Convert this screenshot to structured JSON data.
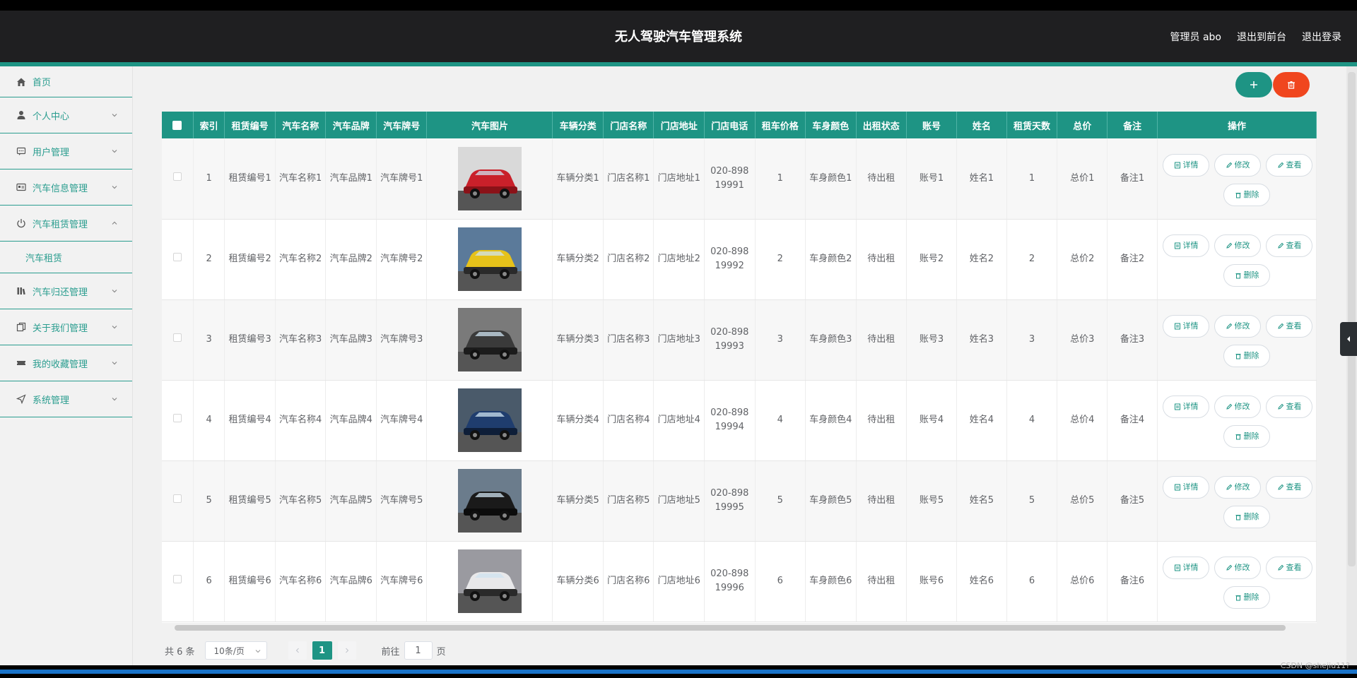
{
  "header": {
    "title": "无人驾驶汽车管理系统",
    "admin": "管理员 abo",
    "exit_front": "退出到前台",
    "logout": "退出登录"
  },
  "sidebar": {
    "items": [
      {
        "label": "首页",
        "icon": "home-icon"
      },
      {
        "label": "个人中心",
        "icon": "user-icon"
      },
      {
        "label": "用户管理",
        "icon": "chat-icon"
      },
      {
        "label": "汽车信息管理",
        "icon": "card-icon"
      },
      {
        "label": "汽车租赁管理",
        "icon": "power-icon",
        "expanded": true,
        "sub": "汽车租赁"
      },
      {
        "label": "汽车归还管理",
        "icon": "bars-icon"
      },
      {
        "label": "关于我们管理",
        "icon": "copy-icon"
      },
      {
        "label": "我的收藏管理",
        "icon": "ticket-icon"
      },
      {
        "label": "系统管理",
        "icon": "send-icon"
      }
    ]
  },
  "toolbar": {
    "add_icon": "+",
    "delete_icon": "trash"
  },
  "table": {
    "headers": [
      "索引",
      "租赁编号",
      "汽车名称",
      "汽车品牌",
      "汽车牌号",
      "汽车图片",
      "车辆分类",
      "门店名称",
      "门店地址",
      "门店电话",
      "租车价格",
      "车身颜色",
      "出租状态",
      "账号",
      "姓名",
      "租赁天数",
      "总价",
      "备注",
      "操作"
    ],
    "rows": [
      {
        "idx": "1",
        "no": "租赁编号1",
        "name": "汽车名称1",
        "brand": "汽车品牌1",
        "plate": "汽车牌号1",
        "cls": "车辆分类1",
        "store": "门店名称1",
        "addr": "门店地址1",
        "phone": "020-89819991",
        "price": "1",
        "color": "车身颜色1",
        "status": "待出租",
        "acct": "账号1",
        "uname": "姓名1",
        "days": "1",
        "total": "总价1",
        "note": "备注1"
      },
      {
        "idx": "2",
        "no": "租赁编号2",
        "name": "汽车名称2",
        "brand": "汽车品牌2",
        "plate": "汽车牌号2",
        "cls": "车辆分类2",
        "store": "门店名称2",
        "addr": "门店地址2",
        "phone": "020-89819992",
        "price": "2",
        "color": "车身颜色2",
        "status": "待出租",
        "acct": "账号2",
        "uname": "姓名2",
        "days": "2",
        "total": "总价2",
        "note": "备注2"
      },
      {
        "idx": "3",
        "no": "租赁编号3",
        "name": "汽车名称3",
        "brand": "汽车品牌3",
        "plate": "汽车牌号3",
        "cls": "车辆分类3",
        "store": "门店名称3",
        "addr": "门店地址3",
        "phone": "020-89819993",
        "price": "3",
        "color": "车身颜色3",
        "status": "待出租",
        "acct": "账号3",
        "uname": "姓名3",
        "days": "3",
        "total": "总价3",
        "note": "备注3"
      },
      {
        "idx": "4",
        "no": "租赁编号4",
        "name": "汽车名称4",
        "brand": "汽车品牌4",
        "plate": "汽车牌号4",
        "cls": "车辆分类4",
        "store": "门店名称4",
        "addr": "门店地址4",
        "phone": "020-89819994",
        "price": "4",
        "color": "车身颜色4",
        "status": "待出租",
        "acct": "账号4",
        "uname": "姓名4",
        "days": "4",
        "total": "总价4",
        "note": "备注4"
      },
      {
        "idx": "5",
        "no": "租赁编号5",
        "name": "汽车名称5",
        "brand": "汽车品牌5",
        "plate": "汽车牌号5",
        "cls": "车辆分类5",
        "store": "门店名称5",
        "addr": "门店地址5",
        "phone": "020-89819995",
        "price": "5",
        "color": "车身颜色5",
        "status": "待出租",
        "acct": "账号5",
        "uname": "姓名5",
        "days": "5",
        "total": "总价5",
        "note": "备注5"
      },
      {
        "idx": "6",
        "no": "租赁编号6",
        "name": "汽车名称6",
        "brand": "汽车品牌6",
        "plate": "汽车牌号6",
        "cls": "车辆分类6",
        "store": "门店名称6",
        "addr": "门店地址6",
        "phone": "020-89819996",
        "price": "6",
        "color": "车身颜色6",
        "status": "待出租",
        "acct": "账号6",
        "uname": "姓名6",
        "days": "6",
        "total": "总价6",
        "note": "备注6"
      }
    ],
    "ops": {
      "detail": "详情",
      "edit": "修改",
      "view": "查看",
      "delete": "删除"
    }
  },
  "pagination": {
    "total": "共 6 条",
    "page_size": "10条/页",
    "current": "1",
    "goto_prefix": "前往",
    "goto_value": "1",
    "goto_suffix": "页"
  },
  "watermark": "CSDN @shejiu11?",
  "colors": {
    "accent": "#1e9484",
    "danger": "#f0461e",
    "header": "#1f1f21"
  }
}
